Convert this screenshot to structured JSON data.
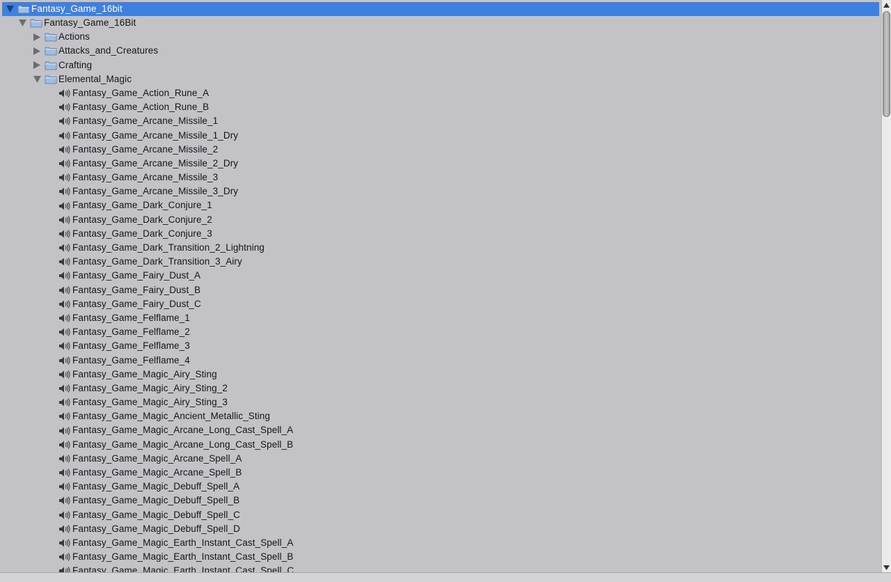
{
  "tree": {
    "root": {
      "label": "Fantasy_Game_16bit",
      "icon": "folder-icon",
      "expanded": true,
      "selected": true
    },
    "child": {
      "label": "Fantasy_Game_16Bit",
      "icon": "folder-icon",
      "expanded": true
    },
    "folders": [
      {
        "label": "Actions",
        "expanded": false
      },
      {
        "label": "Attacks_and_Creatures",
        "expanded": false
      },
      {
        "label": "Crafting",
        "expanded": false
      },
      {
        "label": "Elemental_Magic",
        "expanded": true
      }
    ],
    "files": [
      "Fantasy_Game_Action_Rune_A",
      "Fantasy_Game_Action_Rune_B",
      "Fantasy_Game_Arcane_Missile_1",
      "Fantasy_Game_Arcane_Missile_1_Dry",
      "Fantasy_Game_Arcane_Missile_2",
      "Fantasy_Game_Arcane_Missile_2_Dry",
      "Fantasy_Game_Arcane_Missile_3",
      "Fantasy_Game_Arcane_Missile_3_Dry",
      "Fantasy_Game_Dark_Conjure_1",
      "Fantasy_Game_Dark_Conjure_2",
      "Fantasy_Game_Dark_Conjure_3",
      "Fantasy_Game_Dark_Transition_2_Lightning",
      "Fantasy_Game_Dark_Transition_3_Airy",
      "Fantasy_Game_Fairy_Dust_A",
      "Fantasy_Game_Fairy_Dust_B",
      "Fantasy_Game_Fairy_Dust_C",
      "Fantasy_Game_Felflame_1",
      "Fantasy_Game_Felflame_2",
      "Fantasy_Game_Felflame_3",
      "Fantasy_Game_Felflame_4",
      "Fantasy_Game_Magic_Airy_Sting",
      "Fantasy_Game_Magic_Airy_Sting_2",
      "Fantasy_Game_Magic_Airy_Sting_3",
      "Fantasy_Game_Magic_Ancient_Metallic_Sting",
      "Fantasy_Game_Magic_Arcane_Long_Cast_Spell_A",
      "Fantasy_Game_Magic_Arcane_Long_Cast_Spell_B",
      "Fantasy_Game_Magic_Arcane_Spell_A",
      "Fantasy_Game_Magic_Arcane_Spell_B",
      "Fantasy_Game_Magic_Debuff_Spell_A",
      "Fantasy_Game_Magic_Debuff_Spell_B",
      "Fantasy_Game_Magic_Debuff_Spell_C",
      "Fantasy_Game_Magic_Debuff_Spell_D",
      "Fantasy_Game_Magic_Earth_Instant_Cast_Spell_A",
      "Fantasy_Game_Magic_Earth_Instant_Cast_Spell_B",
      "Fantasy_Game_Magic_Earth_Instant_Cast_Spell_C"
    ],
    "file_icon": "speaker-icon"
  },
  "scrollbar": {
    "position_fraction": 0.0,
    "visible_fraction": 0.19
  },
  "colors": {
    "selection": "#3d80df",
    "background": "#c3c3c7",
    "text": "#141414",
    "folder": "#8fb3dc"
  }
}
